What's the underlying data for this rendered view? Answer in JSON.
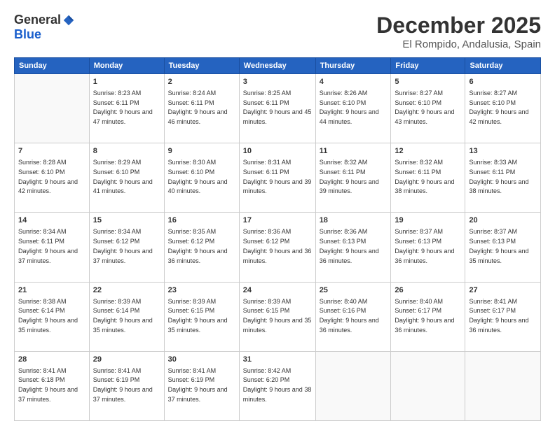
{
  "logo": {
    "general": "General",
    "blue": "Blue"
  },
  "header": {
    "month": "December 2025",
    "location": "El Rompido, Andalusia, Spain"
  },
  "weekdays": [
    "Sunday",
    "Monday",
    "Tuesday",
    "Wednesday",
    "Thursday",
    "Friday",
    "Saturday"
  ],
  "weeks": [
    [
      {
        "day": "",
        "sunrise": "",
        "sunset": "",
        "daylight": ""
      },
      {
        "day": "1",
        "sunrise": "Sunrise: 8:23 AM",
        "sunset": "Sunset: 6:11 PM",
        "daylight": "Daylight: 9 hours and 47 minutes."
      },
      {
        "day": "2",
        "sunrise": "Sunrise: 8:24 AM",
        "sunset": "Sunset: 6:11 PM",
        "daylight": "Daylight: 9 hours and 46 minutes."
      },
      {
        "day": "3",
        "sunrise": "Sunrise: 8:25 AM",
        "sunset": "Sunset: 6:11 PM",
        "daylight": "Daylight: 9 hours and 45 minutes."
      },
      {
        "day": "4",
        "sunrise": "Sunrise: 8:26 AM",
        "sunset": "Sunset: 6:10 PM",
        "daylight": "Daylight: 9 hours and 44 minutes."
      },
      {
        "day": "5",
        "sunrise": "Sunrise: 8:27 AM",
        "sunset": "Sunset: 6:10 PM",
        "daylight": "Daylight: 9 hours and 43 minutes."
      },
      {
        "day": "6",
        "sunrise": "Sunrise: 8:27 AM",
        "sunset": "Sunset: 6:10 PM",
        "daylight": "Daylight: 9 hours and 42 minutes."
      }
    ],
    [
      {
        "day": "7",
        "sunrise": "Sunrise: 8:28 AM",
        "sunset": "Sunset: 6:10 PM",
        "daylight": "Daylight: 9 hours and 42 minutes."
      },
      {
        "day": "8",
        "sunrise": "Sunrise: 8:29 AM",
        "sunset": "Sunset: 6:10 PM",
        "daylight": "Daylight: 9 hours and 41 minutes."
      },
      {
        "day": "9",
        "sunrise": "Sunrise: 8:30 AM",
        "sunset": "Sunset: 6:10 PM",
        "daylight": "Daylight: 9 hours and 40 minutes."
      },
      {
        "day": "10",
        "sunrise": "Sunrise: 8:31 AM",
        "sunset": "Sunset: 6:11 PM",
        "daylight": "Daylight: 9 hours and 39 minutes."
      },
      {
        "day": "11",
        "sunrise": "Sunrise: 8:32 AM",
        "sunset": "Sunset: 6:11 PM",
        "daylight": "Daylight: 9 hours and 39 minutes."
      },
      {
        "day": "12",
        "sunrise": "Sunrise: 8:32 AM",
        "sunset": "Sunset: 6:11 PM",
        "daylight": "Daylight: 9 hours and 38 minutes."
      },
      {
        "day": "13",
        "sunrise": "Sunrise: 8:33 AM",
        "sunset": "Sunset: 6:11 PM",
        "daylight": "Daylight: 9 hours and 38 minutes."
      }
    ],
    [
      {
        "day": "14",
        "sunrise": "Sunrise: 8:34 AM",
        "sunset": "Sunset: 6:11 PM",
        "daylight": "Daylight: 9 hours and 37 minutes."
      },
      {
        "day": "15",
        "sunrise": "Sunrise: 8:34 AM",
        "sunset": "Sunset: 6:12 PM",
        "daylight": "Daylight: 9 hours and 37 minutes."
      },
      {
        "day": "16",
        "sunrise": "Sunrise: 8:35 AM",
        "sunset": "Sunset: 6:12 PM",
        "daylight": "Daylight: 9 hours and 36 minutes."
      },
      {
        "day": "17",
        "sunrise": "Sunrise: 8:36 AM",
        "sunset": "Sunset: 6:12 PM",
        "daylight": "Daylight: 9 hours and 36 minutes."
      },
      {
        "day": "18",
        "sunrise": "Sunrise: 8:36 AM",
        "sunset": "Sunset: 6:13 PM",
        "daylight": "Daylight: 9 hours and 36 minutes."
      },
      {
        "day": "19",
        "sunrise": "Sunrise: 8:37 AM",
        "sunset": "Sunset: 6:13 PM",
        "daylight": "Daylight: 9 hours and 36 minutes."
      },
      {
        "day": "20",
        "sunrise": "Sunrise: 8:37 AM",
        "sunset": "Sunset: 6:13 PM",
        "daylight": "Daylight: 9 hours and 35 minutes."
      }
    ],
    [
      {
        "day": "21",
        "sunrise": "Sunrise: 8:38 AM",
        "sunset": "Sunset: 6:14 PM",
        "daylight": "Daylight: 9 hours and 35 minutes."
      },
      {
        "day": "22",
        "sunrise": "Sunrise: 8:39 AM",
        "sunset": "Sunset: 6:14 PM",
        "daylight": "Daylight: 9 hours and 35 minutes."
      },
      {
        "day": "23",
        "sunrise": "Sunrise: 8:39 AM",
        "sunset": "Sunset: 6:15 PM",
        "daylight": "Daylight: 9 hours and 35 minutes."
      },
      {
        "day": "24",
        "sunrise": "Sunrise: 8:39 AM",
        "sunset": "Sunset: 6:15 PM",
        "daylight": "Daylight: 9 hours and 35 minutes."
      },
      {
        "day": "25",
        "sunrise": "Sunrise: 8:40 AM",
        "sunset": "Sunset: 6:16 PM",
        "daylight": "Daylight: 9 hours and 36 minutes."
      },
      {
        "day": "26",
        "sunrise": "Sunrise: 8:40 AM",
        "sunset": "Sunset: 6:17 PM",
        "daylight": "Daylight: 9 hours and 36 minutes."
      },
      {
        "day": "27",
        "sunrise": "Sunrise: 8:41 AM",
        "sunset": "Sunset: 6:17 PM",
        "daylight": "Daylight: 9 hours and 36 minutes."
      }
    ],
    [
      {
        "day": "28",
        "sunrise": "Sunrise: 8:41 AM",
        "sunset": "Sunset: 6:18 PM",
        "daylight": "Daylight: 9 hours and 37 minutes."
      },
      {
        "day": "29",
        "sunrise": "Sunrise: 8:41 AM",
        "sunset": "Sunset: 6:19 PM",
        "daylight": "Daylight: 9 hours and 37 minutes."
      },
      {
        "day": "30",
        "sunrise": "Sunrise: 8:41 AM",
        "sunset": "Sunset: 6:19 PM",
        "daylight": "Daylight: 9 hours and 37 minutes."
      },
      {
        "day": "31",
        "sunrise": "Sunrise: 8:42 AM",
        "sunset": "Sunset: 6:20 PM",
        "daylight": "Daylight: 9 hours and 38 minutes."
      },
      {
        "day": "",
        "sunrise": "",
        "sunset": "",
        "daylight": ""
      },
      {
        "day": "",
        "sunrise": "",
        "sunset": "",
        "daylight": ""
      },
      {
        "day": "",
        "sunrise": "",
        "sunset": "",
        "daylight": ""
      }
    ]
  ]
}
